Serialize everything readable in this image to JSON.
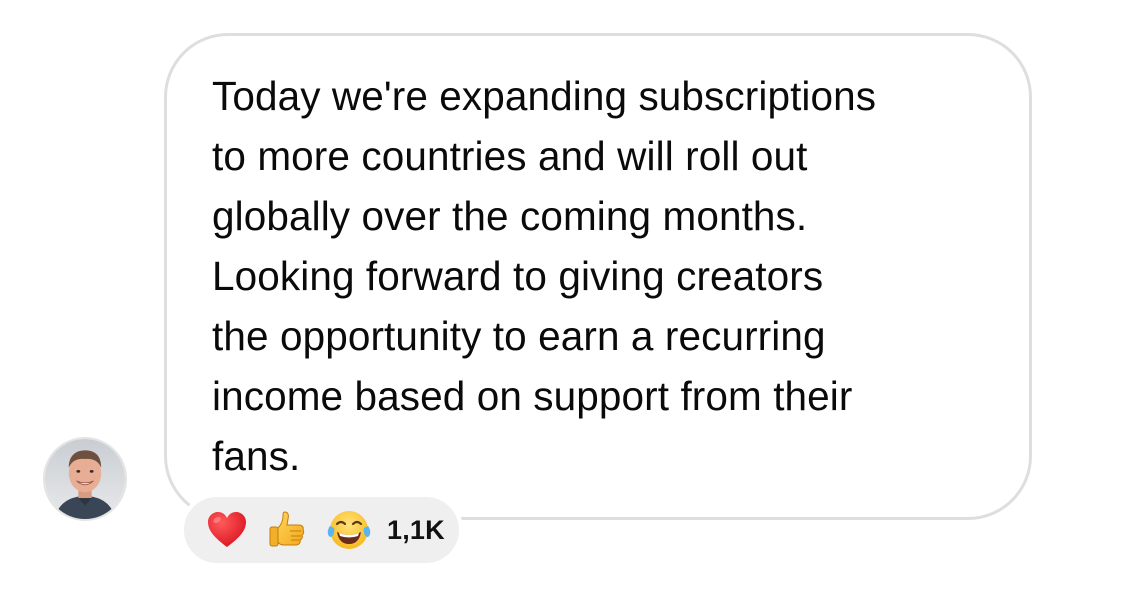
{
  "message": {
    "lines": [
      "Today we're expanding subscriptions",
      "to more countries and will roll out",
      "globally over the coming months.",
      "Looking forward to giving creators",
      "the opportunity to earn a recurring",
      "income based on support from their",
      "fans."
    ]
  },
  "reactions": {
    "items": [
      {
        "icon": "red-heart-icon"
      },
      {
        "icon": "thumbs-up-icon"
      },
      {
        "icon": "tears-of-joy-icon"
      }
    ],
    "count": "1,1K"
  },
  "colors": {
    "bubble_border": "#dedede",
    "reaction_pill": "#efefef",
    "text": "#0a0a0a"
  }
}
